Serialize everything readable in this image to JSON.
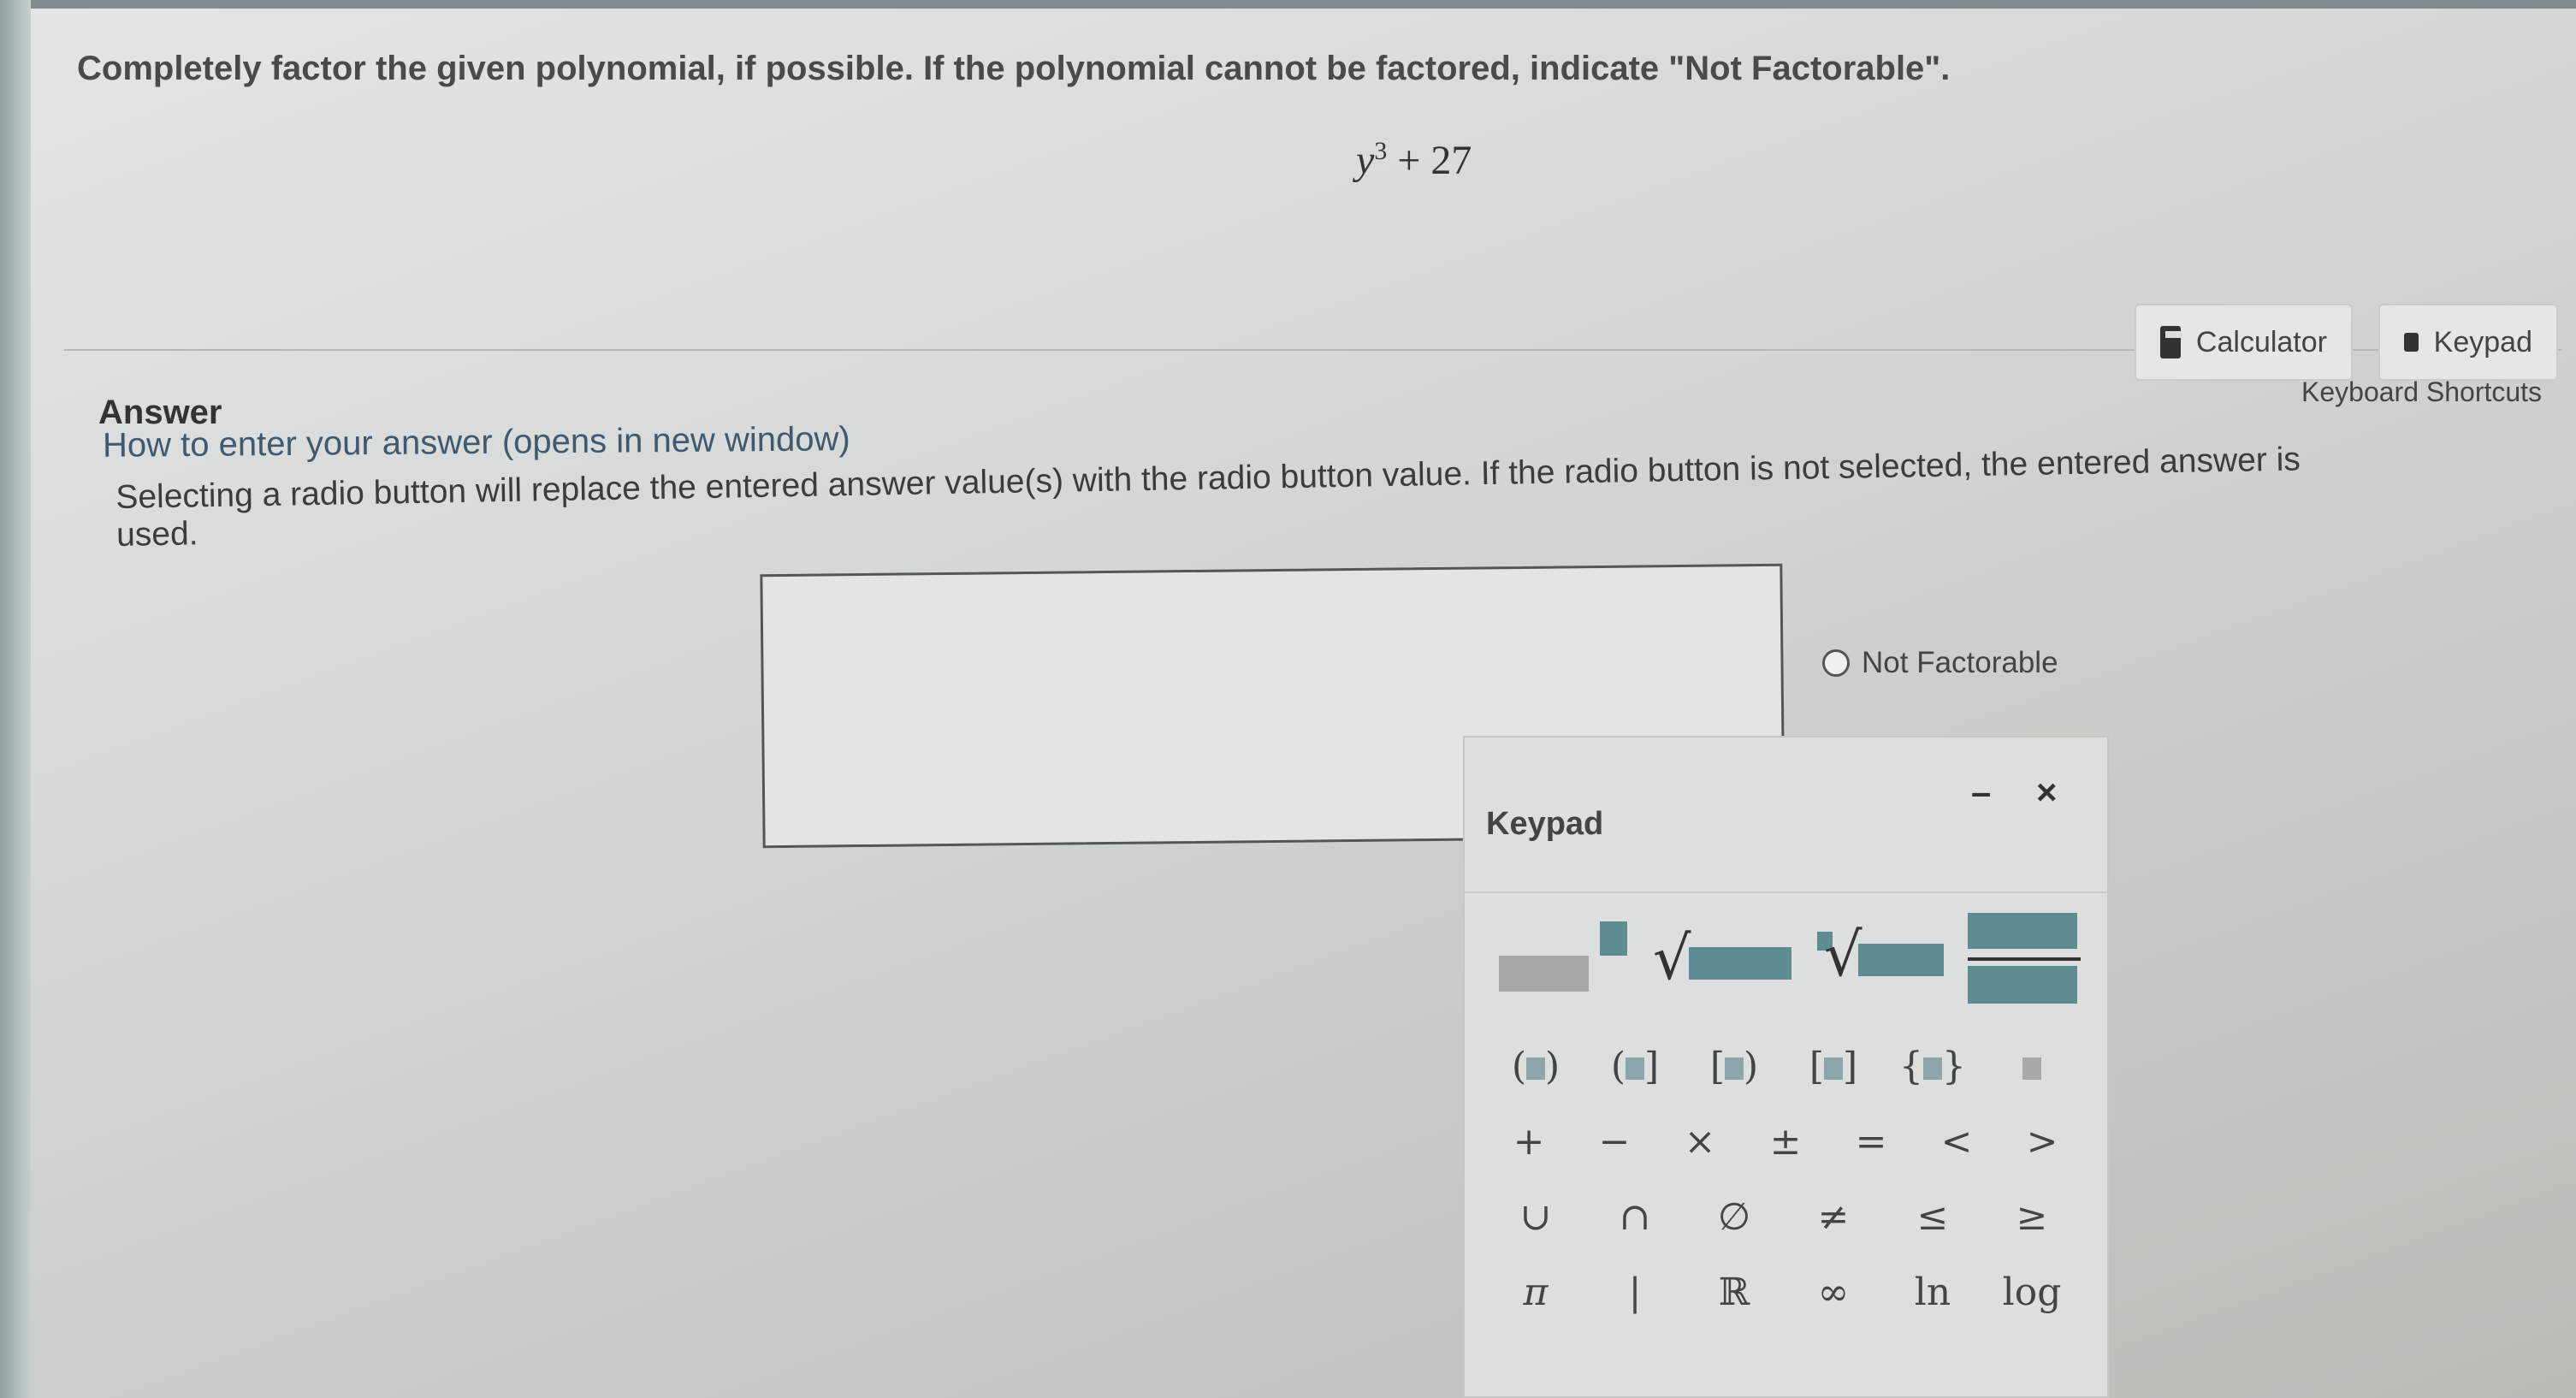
{
  "question": {
    "text": "Completely factor the given polynomial, if possible. If the polynomial cannot be factored, indicate \"Not Factorable\".",
    "expression_base": "y",
    "expression_exp": "3",
    "expression_rest": " + 27"
  },
  "tools": {
    "calculator_label": "Calculator",
    "keypad_label": "Keypad",
    "shortcuts_label": "Keyboard Shortcuts"
  },
  "answer": {
    "label": "Answer",
    "howto_link": "How to enter your answer (opens in new window)",
    "instruction": "Selecting a radio button will replace the entered answer value(s) with the radio button value. If the radio button is not selected, the entered answer is used.",
    "input_value": "",
    "radio_label": "Not Factorable"
  },
  "keypad": {
    "title": "Keypad",
    "minimize_symbol": "–",
    "close_symbol": "×",
    "row1": [
      "(",
      "(",
      "[",
      "[",
      "{",
      ""
    ],
    "row1_close": [
      ")",
      "]",
      ")",
      "]",
      "}",
      ""
    ],
    "row2": [
      "+",
      "−",
      "×",
      "±",
      "=",
      "<",
      ">"
    ],
    "row3": [
      "∪",
      "∩",
      "∅",
      "≠",
      "≤",
      "≥"
    ],
    "row4": [
      "π",
      "|",
      "ℝ",
      "∞",
      "ln",
      "log"
    ]
  },
  "colors": {
    "template_block": "#5e8c93",
    "link": "#3f5a70"
  },
  "icons": [
    "calculator-icon",
    "keyboard-icon",
    "radio-icon"
  ]
}
